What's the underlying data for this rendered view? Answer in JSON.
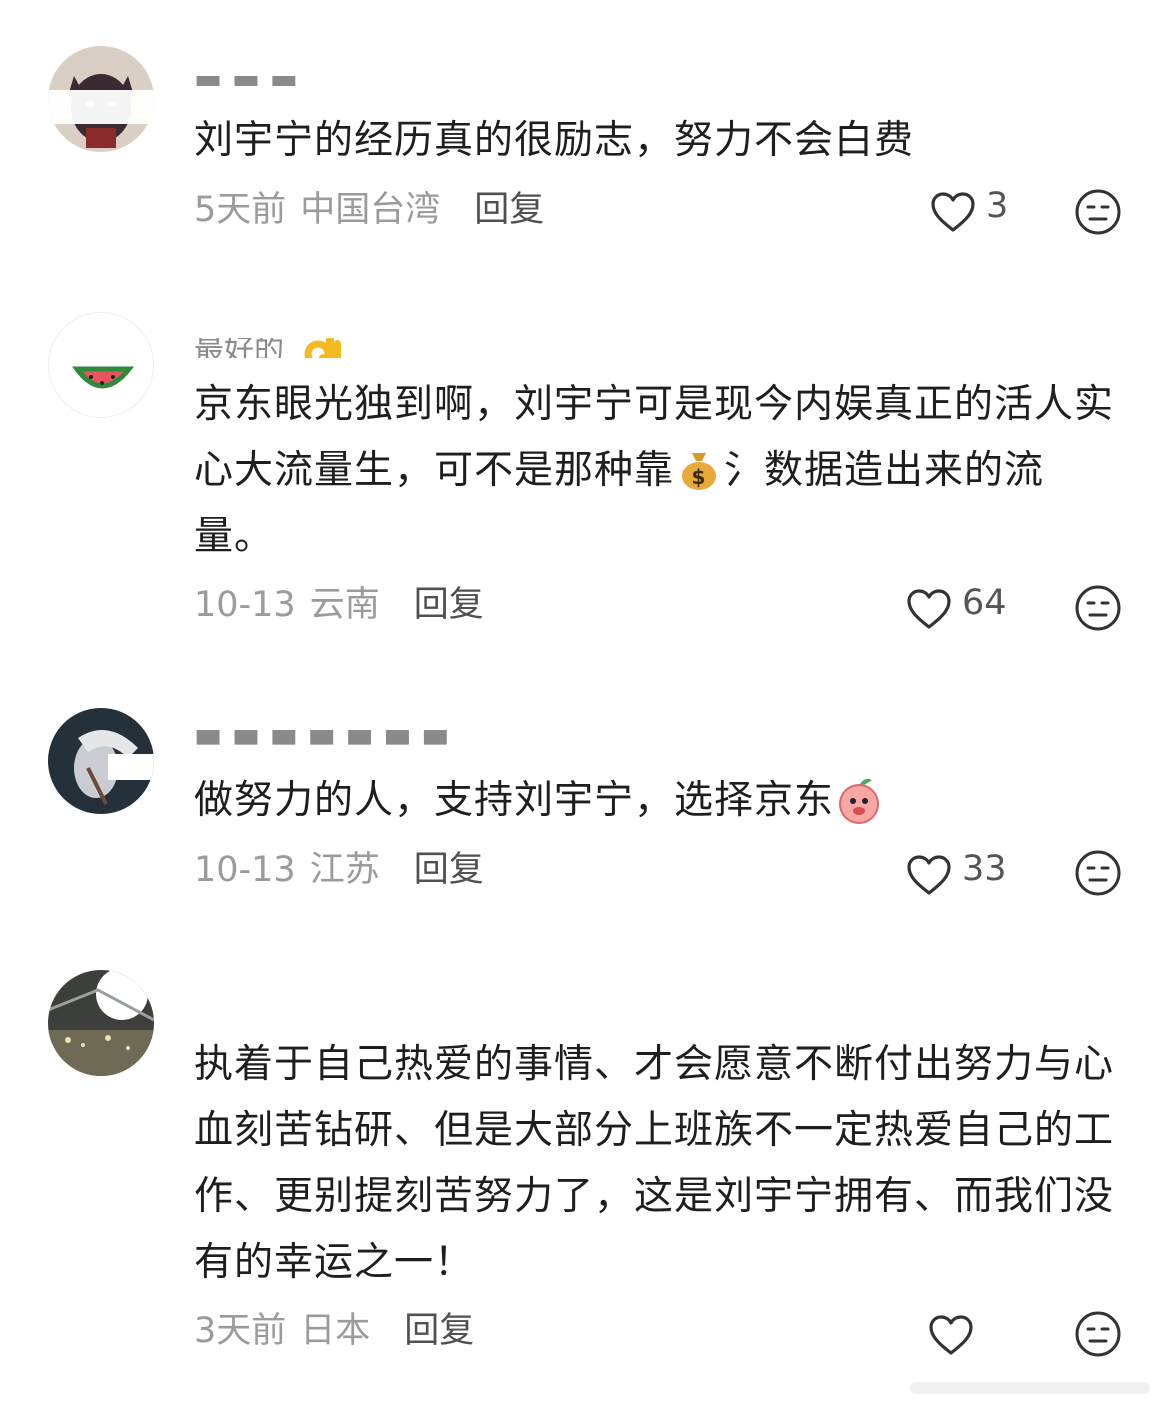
{
  "comments": [
    {
      "username": "",
      "text": "刘宇宁的经历真的很励志，努力不会白费",
      "date": "5天前",
      "location": "中国台湾",
      "reply_label": "回复",
      "likes": "3"
    },
    {
      "username": "最好的",
      "text_part1": "京东眼光独到啊，刘宇宁可是现今内娱真正的活人实心大流量生，可不是那种靠",
      "text_part2": "氵数据造出来的流量。",
      "date": "10-13",
      "location": "云南",
      "reply_label": "回复",
      "likes": "64"
    },
    {
      "username": "",
      "text": "做努力的人，支持刘宇宁，选择京东",
      "date": "10-13",
      "location": "江苏",
      "reply_label": "回复",
      "likes": "33"
    },
    {
      "username": "",
      "text": "执着于自己热爱的事情、才会愿意不断付出努力与心血刻苦钻研、但是大部分上班族不一定热爱自己的工作、更别提刻苦努力了，这是刘宇宁拥有、而我们没有的幸运之一！",
      "date": "3天前",
      "location": "日本",
      "reply_label": "回复",
      "likes": ""
    }
  ],
  "icons": {
    "like": "heart-outline-icon",
    "dislike": "neutral-face-icon",
    "ok_emoji": "ok-hand-emoji",
    "money_emoji": "money-bag-emoji",
    "peach_emoji": "peach-emoji"
  },
  "colors": {
    "text_primary": "#1e1e1e",
    "text_secondary": "#9b9b9b",
    "reply": "#505050",
    "icon": "#333333"
  }
}
